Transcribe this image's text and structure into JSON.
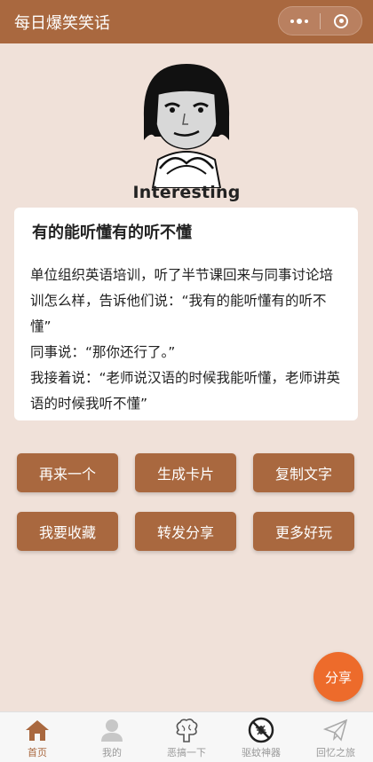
{
  "header": {
    "title": "每日爆笑笑话"
  },
  "meme": {
    "caption": "Interesting"
  },
  "joke": {
    "title": "有的能听懂有的听不懂",
    "paragraphs": [
      "单位组织英语培训，听了半节课回来与同事讨论培训怎么样，告诉他们说：“我有的能听懂有的听不懂”",
      "同事说：“那你还行了。”",
      "我接着说：“老师说汉语的时候我能听懂，老师讲英语的时候我听不懂”"
    ]
  },
  "actions": {
    "row1": [
      "再来一个",
      "生成卡片",
      "复制文字"
    ],
    "row2": [
      "我要收藏",
      "转发分享",
      "更多好玩"
    ]
  },
  "fab": {
    "label": "分享"
  },
  "tabbar": {
    "items": [
      {
        "label": "首页",
        "icon": "home-icon",
        "active": true
      },
      {
        "label": "我的",
        "icon": "user-icon",
        "active": false
      },
      {
        "label": "恶搞一下",
        "icon": "brain-icon",
        "active": false
      },
      {
        "label": "驱蚊神器",
        "icon": "no-mosquito-icon",
        "active": false
      },
      {
        "label": "回忆之旅",
        "icon": "paper-plane-icon",
        "active": false
      }
    ]
  },
  "colors": {
    "accent": "#a9683f",
    "background": "#f0e1d9",
    "fab": "#ed6b2b"
  }
}
